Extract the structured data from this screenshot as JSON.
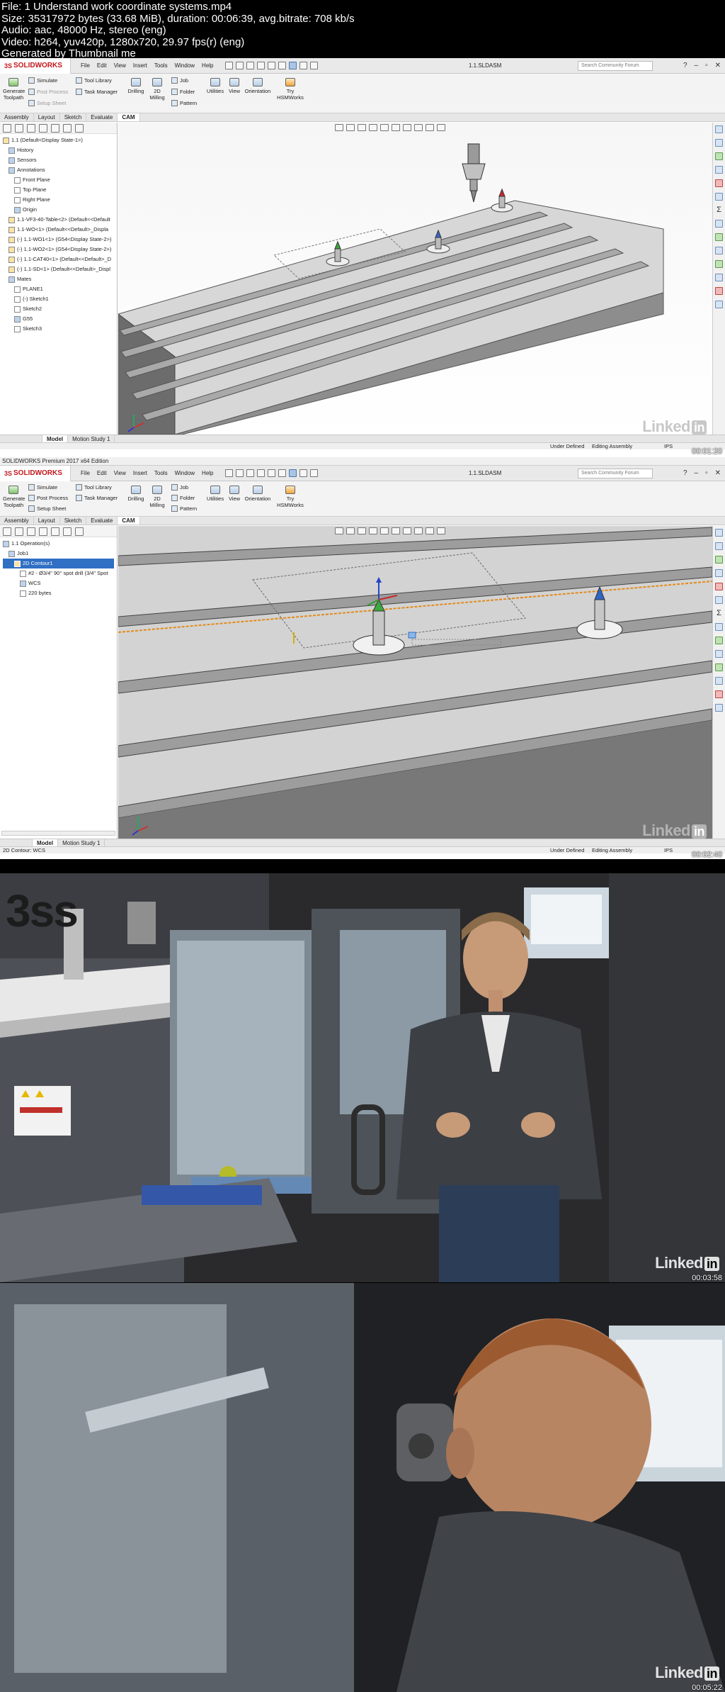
{
  "header": {
    "line1": "File: 1 Understand work coordinate systems.mp4",
    "line2": "Size: 35317972 bytes (33.68 MiB), duration: 00:06:39, avg.bitrate: 708 kb/s",
    "line3": "Audio: aac, 48000 Hz, stereo (eng)",
    "line4": "Video: h264, yuv420p, 1280x720, 29.97 fps(r) (eng)",
    "line5": "Generated by Thumbnail me"
  },
  "app": {
    "logo": "SOLIDWORKS",
    "logo_mark": "3S",
    "menus": [
      "File",
      "Edit",
      "View",
      "Insert",
      "Tools",
      "Window",
      "Help"
    ],
    "doc_title": "1.1.SLDASM",
    "search_placeholder": "Search Community Forum",
    "win_controls": [
      "?",
      "–",
      "▫",
      "✕"
    ],
    "frame2_title_bar": "SOLIDWORKS Premium 2017 x64 Edition"
  },
  "command_manager": {
    "generate_toolpath": "Generate Toolpath",
    "simulate": "Simulate",
    "post_process": "Post Process",
    "setup_sheet": "Setup Sheet",
    "tool_library": "Tool Library",
    "task_manager": "Task Manager",
    "drilling": "Drilling",
    "milling_2d": "2D Milling",
    "job": "Job",
    "folder": "Folder",
    "pattern": "Pattern",
    "utilities": "Utilities",
    "view": "View",
    "orientation": "Orientation",
    "try_hsmworks": "Try HSMWorks"
  },
  "tabs": [
    "Assembly",
    "Layout",
    "Sketch",
    "Evaluate",
    "CAM"
  ],
  "active_tab": "CAM",
  "frame1": {
    "tree": [
      "1.1 (Default<Display State-1>)",
      "History",
      "Sensors",
      "Annotations",
      "Front Plane",
      "Top Plane",
      "Right Plane",
      "Origin",
      "1.1-VF3-40-Table<2> (Default<<Default",
      "1.1-WO<1> (Default<<Default>_Displa",
      "(-) 1.1-WO1<1> (G54<Display State-2>)",
      "(-) 1.1-WO2<1> (G54<Display State-2>)",
      "(-) 1.1-CAT40<1> (Default<<Default>_D",
      "(-) 1.1-SD<1> (Default<<Default>_Displ",
      "Mates",
      "PLANE1",
      "(-) Sketch1",
      "Sketch2",
      "G55",
      "Sketch3"
    ],
    "bottom_tabs": [
      "Model",
      "Motion Study 1"
    ],
    "status_under": "Under Defined",
    "status_editing": "Editing Assembly",
    "status_units": "IPS",
    "watermark": "Linked",
    "watermark_in": "in",
    "time": "00:01:20"
  },
  "frame2": {
    "tree": [
      "1.1 Operation(s)",
      "Job1",
      "2D Contour1",
      "#2 - Ø3/4\" 90° spot drill (3/4\" Spot",
      "WCS",
      "220 bytes"
    ],
    "bottom_tabs": [
      "Model",
      "Motion Study 1"
    ],
    "status_left": "2D Contour: WCS",
    "status_under": "Under Defined",
    "status_editing": "Editing Assembly",
    "status_units": "IPS",
    "watermark": "Linked",
    "watermark_in": "in",
    "time": "00:02:40"
  },
  "frame3": {
    "machine_label": "3ss",
    "watermark": "Linked",
    "watermark_in": "in",
    "time": "00:03:58"
  },
  "frame4": {
    "watermark": "Linked",
    "watermark_in": "in",
    "time": "00:05:22"
  },
  "colors": {
    "solidworks_red": "#c4161c",
    "selection_blue": "#2f6fc4",
    "table_gray": "#c9c9c9"
  }
}
